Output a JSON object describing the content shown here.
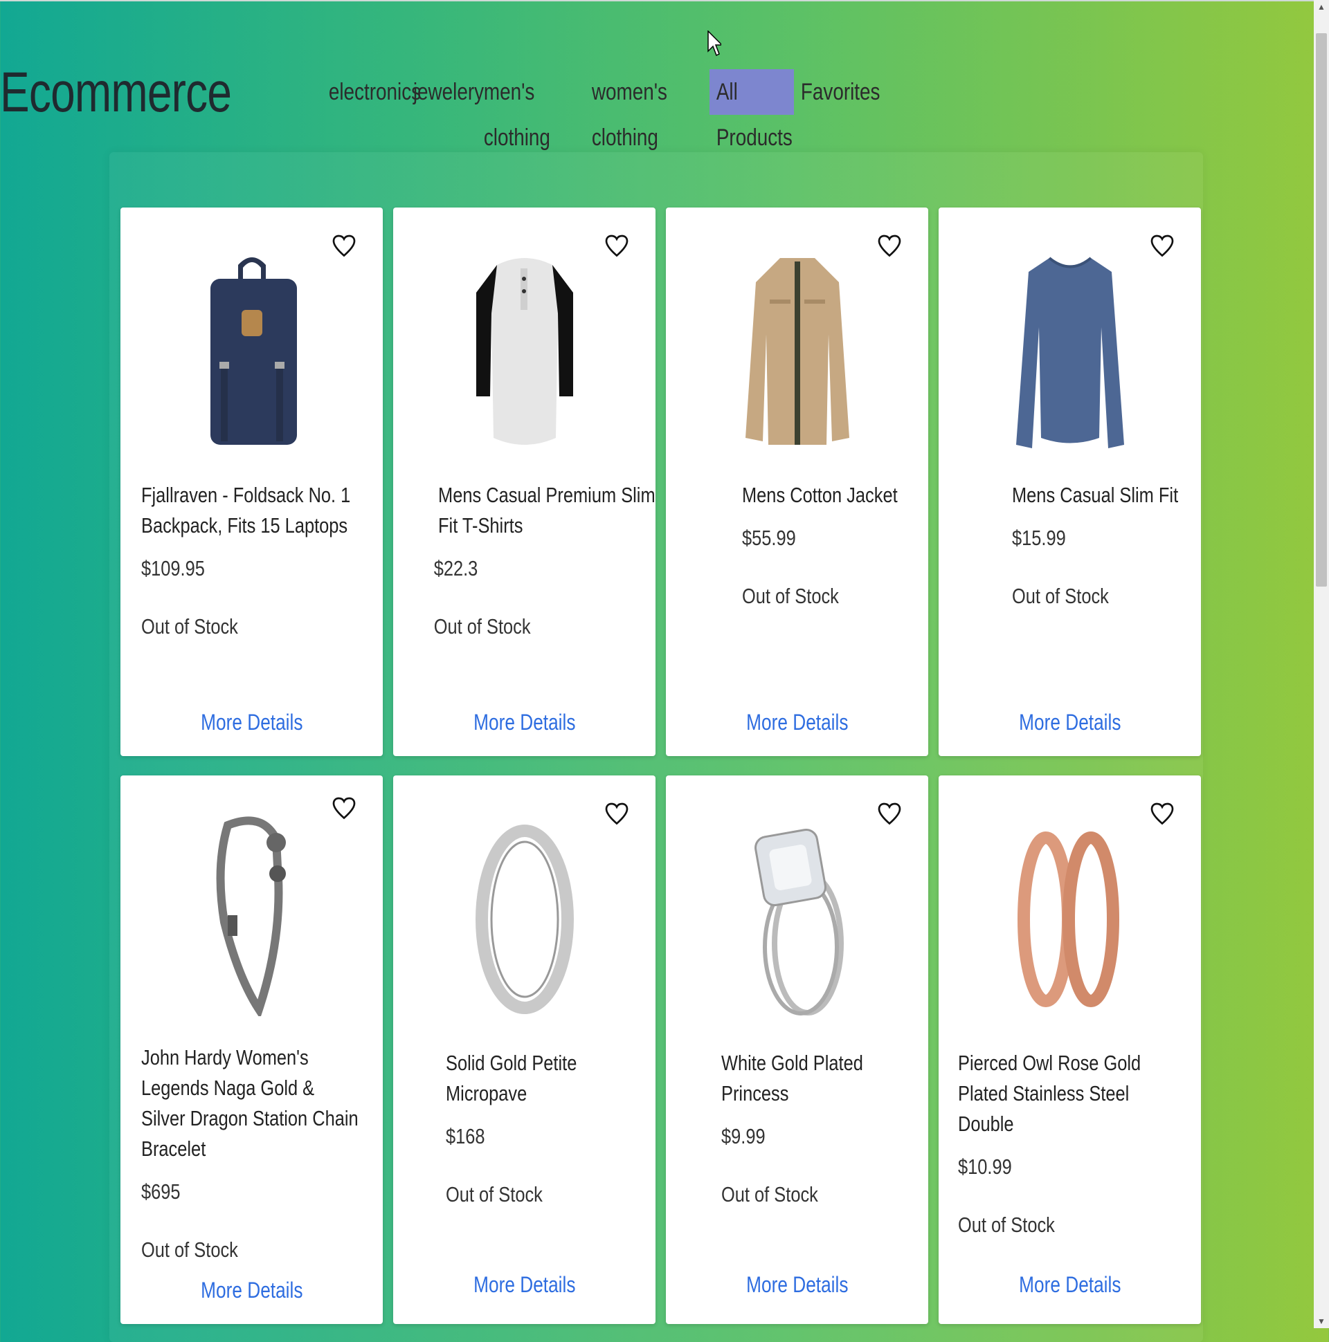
{
  "brand": "Ecommerce",
  "nav": [
    "electronics",
    "jewelery",
    "men's clothing",
    "women's clothing",
    "All Products",
    "Favorites"
  ],
  "active_nav": "All Products",
  "accent_colors": {
    "active_tab": "#7d86cf",
    "link": "#2e6de0"
  },
  "link_label": "More Details",
  "products": [
    {
      "title": "Fjallraven - Foldsack No. 1 Backpack, Fits 15 Laptops",
      "price": "$109.95",
      "stock": "Out of Stock",
      "image": "navy-backpack"
    },
    {
      "title": "Mens Casual Premium Slim Fit T-Shirts",
      "price": "$22.3",
      "stock": "Out of Stock",
      "image": "raglan-tshirt"
    },
    {
      "title": "Mens Cotton Jacket",
      "price": "$55.99",
      "stock": "Out of Stock",
      "image": "khaki-jacket"
    },
    {
      "title": "Mens Casual Slim Fit",
      "price": "$15.99",
      "stock": "Out of Stock",
      "image": "blue-longsleeve"
    },
    {
      "title": "John Hardy Women's Legends Naga Gold & Silver Dragon Station Chain Bracelet",
      "price": "$695",
      "stock": "Out of Stock",
      "image": "dragon-bracelet"
    },
    {
      "title": "Solid Gold Petite Micropave",
      "price": "$168",
      "stock": "Out of Stock",
      "image": "silver-band-ring"
    },
    {
      "title": "White Gold Plated Princess",
      "price": "$9.99",
      "stock": "Out of Stock",
      "image": "diamond-ring"
    },
    {
      "title": "Pierced Owl Rose Gold Plated Stainless Steel Double",
      "price": "$10.99",
      "stock": "Out of Stock",
      "image": "rose-gold-tunnels"
    }
  ]
}
